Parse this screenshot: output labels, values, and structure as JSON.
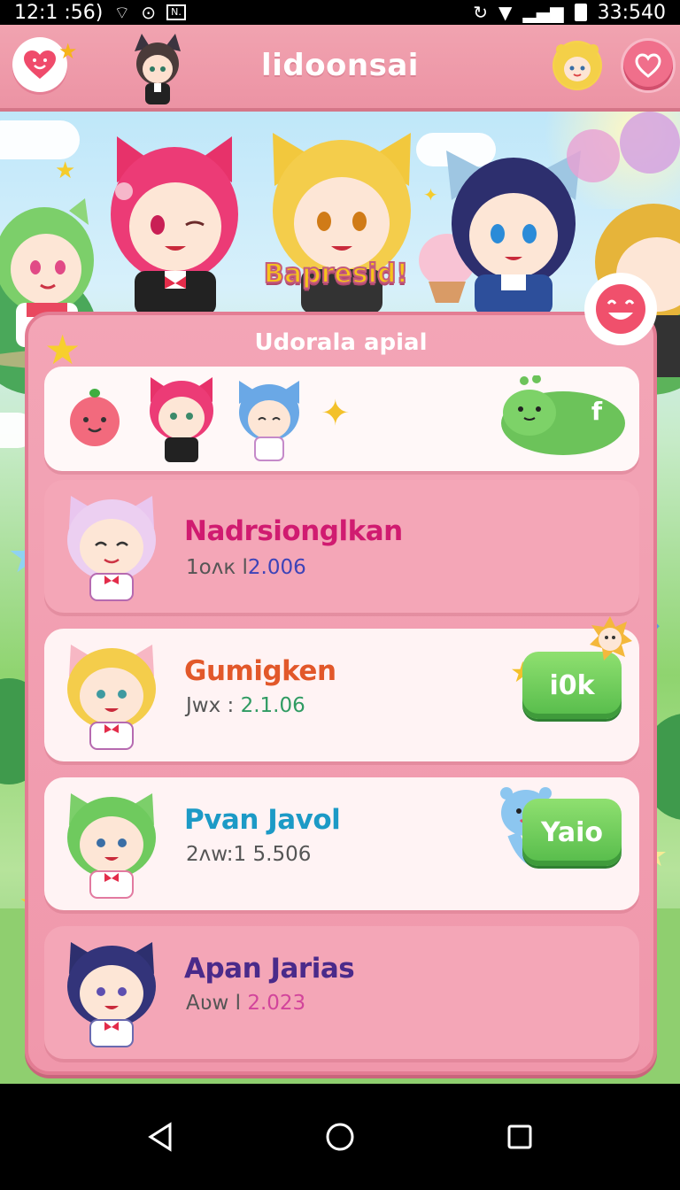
{
  "status": {
    "time_left": "12:1 :56)",
    "time_right": "33:540",
    "left_box": "N."
  },
  "app": {
    "title": "lidoonsai"
  },
  "banner": {
    "caption": "Bapresid!"
  },
  "panel": {
    "title": "Udorala apial",
    "featured_tag": "f"
  },
  "rows": [
    {
      "name": "Nadrsionglkan",
      "meta_prefix": "1oʌк l",
      "meta_value": "2.006",
      "name_color": "#d01b70",
      "value_color": "#3d43b8",
      "action": ""
    },
    {
      "name": "Gumigken",
      "meta_prefix": "Jwx : ",
      "meta_value": "2.1.06",
      "name_color": "#e2582a",
      "value_color": "#2f9b62",
      "action": "i0k"
    },
    {
      "name": "Pvan Javol",
      "meta_prefix": "2ʌw:1 ",
      "meta_value": "5.506",
      "name_color": "#1c9ac6",
      "value_color": "#555",
      "action": "Yaio"
    },
    {
      "name": "Apan Jarias",
      "meta_prefix": "Aʋw l ",
      "meta_value": "2.023",
      "name_color": "#4a2a8a",
      "value_color": "#d2449b",
      "action": ""
    }
  ]
}
